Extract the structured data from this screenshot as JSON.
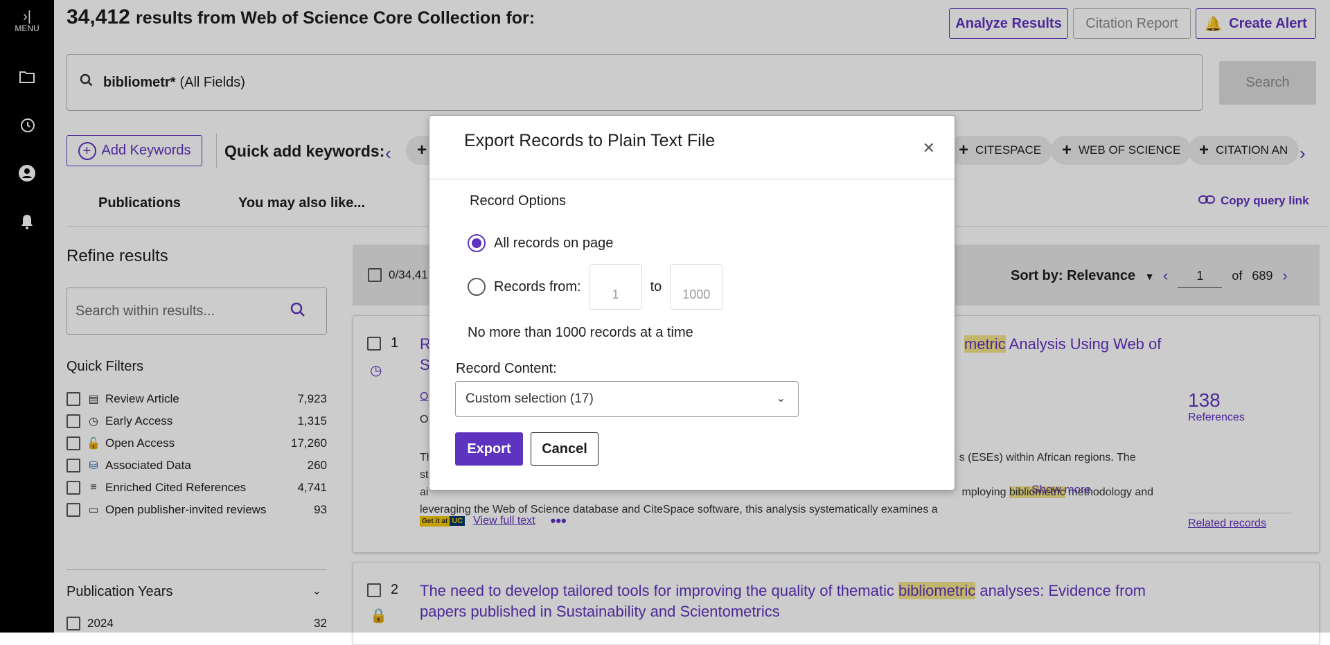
{
  "rail": {
    "menu_label": "MENU"
  },
  "header": {
    "count": "34,412",
    "text": "results from Web of Science Core Collection for:",
    "analyze": "Analyze Results",
    "citation": "Citation Report",
    "alert": "Create Alert"
  },
  "search": {
    "query": "bibliometr*",
    "field": "(All Fields)",
    "button": "Search"
  },
  "keywords": {
    "add": "Add Keywords",
    "quick": "Quick add keywords:",
    "chips": [
      "CITESPACE",
      "WEB OF SCIENCE",
      "CITATION AN"
    ]
  },
  "tabs": {
    "publications": "Publications",
    "also": "You may also like...",
    "copy": "Copy query link"
  },
  "refine": {
    "title": "Refine results",
    "within_placeholder": "Search within results...",
    "quick_filters": "Quick Filters",
    "filters": [
      {
        "label": "Review Article",
        "count": "7,923",
        "icon": "document-icon"
      },
      {
        "label": "Early Access",
        "count": "1,315",
        "icon": "clock-icon"
      },
      {
        "label": "Open Access",
        "count": "17,260",
        "icon": "lock-open-icon"
      },
      {
        "label": "Associated Data",
        "count": "260",
        "icon": "database-icon"
      },
      {
        "label": "Enriched Cited References",
        "count": "4,741",
        "icon": "list-star-icon"
      },
      {
        "label": "Open publisher-invited reviews",
        "count": "93",
        "icon": "comment-icon"
      }
    ],
    "pub_years": "Publication Years",
    "year": {
      "label": "2024",
      "count": "32"
    }
  },
  "results_bar": {
    "selected": "0/34,41",
    "sort": "Sort by: Relevance",
    "page": "1",
    "of": "of",
    "total": "689"
  },
  "records": [
    {
      "num": "1",
      "title_hl": "metric",
      "title_after": " Analysis Using Web of",
      "title_line2_start": "S",
      "refs_count": "138",
      "refs_label": "References",
      "snippet_1a": "Th",
      "snippet_1b": "s (ESEs) within African regions. The study",
      "snippet_2a": "ai",
      "snippet_2b": "mploying ",
      "snippet_2hl": "bibliometric",
      "snippet_2c": " methodology and",
      "snippet_3": "leveraging the Web of Science database and CiteSpace software, this analysis systematically examines a",
      "show_more": "Show more",
      "ellipsis": "...",
      "full_text": "View full text",
      "badge1": "Get it at",
      "badge2": "UC",
      "related": "Related records",
      "o_text": "O",
      "o_text2": "O"
    },
    {
      "num": "2",
      "title_before": "The need to develop tailored tools for improving the quality of thematic ",
      "title_hl": "bibliometric",
      "title_after": " analyses: Evidence from",
      "title_line2": "papers published in Sustainability and Scientometrics"
    }
  ],
  "modal": {
    "title": "Export Records to Plain Text File",
    "record_options": "Record Options",
    "all_on_page": "All records on page",
    "records_from": "Records from:",
    "from_placeholder": "1",
    "to": "to",
    "to_placeholder": "1000",
    "limit": "No more than 1000 records at a time",
    "content_label": "Record Content:",
    "content_value": "Custom selection (17)",
    "export": "Export",
    "cancel": "Cancel"
  },
  "colors": {
    "accent": "#5e33bf",
    "highlight": "#f3e48a"
  }
}
